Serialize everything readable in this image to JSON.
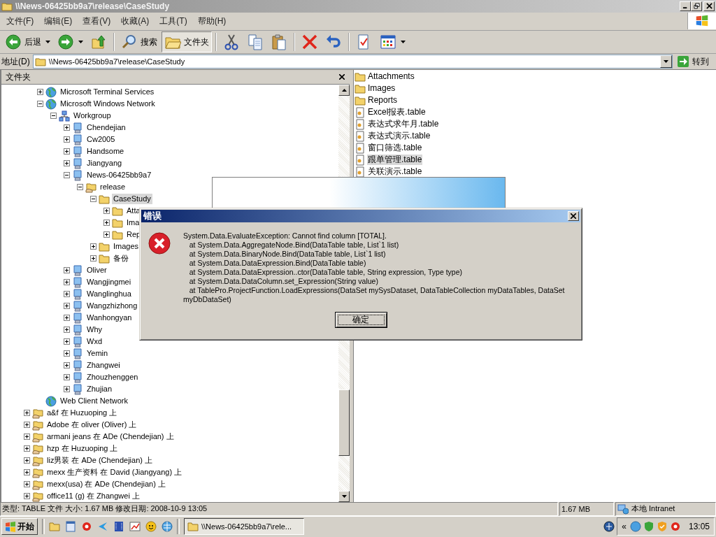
{
  "window": {
    "title": "\\\\News-06425bb9a7\\release\\CaseStudy"
  },
  "menu": [
    "文件(F)",
    "编辑(E)",
    "查看(V)",
    "收藏(A)",
    "工具(T)",
    "帮助(H)"
  ],
  "toolbar": [
    {
      "kind": "back",
      "label": "后退",
      "dropdown": true
    },
    {
      "kind": "forward",
      "dropdown": true
    },
    {
      "kind": "up",
      "dropdown": false
    },
    {
      "kind": "search",
      "label": "搜索",
      "dropdown": false,
      "selected": false
    },
    {
      "kind": "folders",
      "label": "文件夹",
      "dropdown": false,
      "selected": true
    },
    {
      "kind": "cut",
      "dropdown": false
    },
    {
      "kind": "copy",
      "dropdown": false
    },
    {
      "kind": "paste",
      "dropdown": false
    },
    {
      "kind": "delete",
      "dropdown": false
    },
    {
      "kind": "undo",
      "dropdown": false
    },
    {
      "kind": "properties",
      "dropdown": false
    },
    {
      "kind": "views",
      "dropdown": true
    }
  ],
  "address": {
    "label": "地址(D)",
    "value": "\\\\News-06425bb9a7\\release\\CaseStudy",
    "go": "转到"
  },
  "folders_pane": {
    "title": "文件夹",
    "tree": [
      {
        "kind": "network",
        "label": "Microsoft Terminal Services",
        "expanded": false,
        "selected": false
      },
      {
        "kind": "network",
        "label": "Microsoft Windows Network",
        "expanded": true,
        "selected": false,
        "children": [
          {
            "kind": "workgroup",
            "label": "Workgroup",
            "expanded": true,
            "selected": false,
            "children": [
              {
                "kind": "computer",
                "label": "Chendejian",
                "expanded": false,
                "selected": false
              },
              {
                "kind": "computer",
                "label": "Cw2005",
                "expanded": false,
                "selected": false
              },
              {
                "kind": "computer",
                "label": "Handsome",
                "expanded": false,
                "selected": false
              },
              {
                "kind": "computer",
                "label": "Jiangyang",
                "expanded": false,
                "selected": false
              },
              {
                "kind": "computer",
                "label": "News-06425bb9a7",
                "expanded": true,
                "selected": false,
                "children": [
                  {
                    "kind": "share",
                    "label": "release",
                    "expanded": true,
                    "selected": false,
                    "children": [
                      {
                        "kind": "folder",
                        "label": "CaseStudy",
                        "expanded": true,
                        "selected": true,
                        "children": [
                          {
                            "kind": "folder",
                            "label": "Atta",
                            "expanded": false,
                            "selected": false
                          },
                          {
                            "kind": "folder",
                            "label": "Ima",
                            "expanded": false,
                            "selected": false
                          },
                          {
                            "kind": "folder",
                            "label": "Rep",
                            "expanded": false,
                            "selected": false
                          }
                        ]
                      },
                      {
                        "kind": "folder",
                        "label": "Images",
                        "expanded": false,
                        "selected": false
                      },
                      {
                        "kind": "folder",
                        "label": "备份",
                        "expanded": false,
                        "selected": false
                      }
                    ]
                  }
                ]
              },
              {
                "kind": "computer",
                "label": "Oliver",
                "expanded": false,
                "selected": false
              },
              {
                "kind": "computer",
                "label": "Wangjingmei",
                "expanded": false,
                "selected": false
              },
              {
                "kind": "computer",
                "label": "Wanglinghua",
                "expanded": false,
                "selected": false
              },
              {
                "kind": "computer",
                "label": "Wangzhizhong",
                "expanded": false,
                "selected": false
              },
              {
                "kind": "computer",
                "label": "Wanhongyan",
                "expanded": false,
                "selected": false
              },
              {
                "kind": "computer",
                "label": "Why",
                "expanded": false,
                "selected": false
              },
              {
                "kind": "computer",
                "label": "Wxd",
                "expanded": false,
                "selected": false
              },
              {
                "kind": "computer",
                "label": "Yemin",
                "expanded": false,
                "selected": false
              },
              {
                "kind": "computer",
                "label": "Zhangwei",
                "expanded": false,
                "selected": false
              },
              {
                "kind": "computer",
                "label": "Zhouzhenggen",
                "expanded": false,
                "selected": false
              },
              {
                "kind": "computer",
                "label": "Zhujian",
                "expanded": false,
                "selected": false
              }
            ]
          }
        ]
      },
      {
        "kind": "network",
        "label": "Web Client Network",
        "selected": false
      },
      {
        "kind": "share",
        "label": "a&f 在 Huzuoping 上",
        "expanded": false,
        "selected": false
      },
      {
        "kind": "share",
        "label": "Adobe 在 oliver (Oliver) 上",
        "expanded": false,
        "selected": false
      },
      {
        "kind": "share",
        "label": "armani jeans 在 ADe (Chendejian) 上",
        "expanded": false,
        "selected": false
      },
      {
        "kind": "share",
        "label": "hzp 在 Huzuoping 上",
        "expanded": false,
        "selected": false
      },
      {
        "kind": "share",
        "label": "liz男装 在 ADe (Chendejian) 上",
        "expanded": false,
        "selected": false
      },
      {
        "kind": "share",
        "label": "mexx 生产资料 在 David (Jiangyang) 上",
        "expanded": false,
        "selected": false
      },
      {
        "kind": "share",
        "label": "mexx(usa) 在 ADe (Chendejian) 上",
        "expanded": false,
        "selected": false
      },
      {
        "kind": "share",
        "label": "office11 (g) 在 Zhangwei 上",
        "expanded": false,
        "selected": false
      }
    ]
  },
  "files": [
    {
      "kind": "folder",
      "name": "Attachments",
      "selected": false
    },
    {
      "kind": "folder",
      "name": "Images",
      "selected": false
    },
    {
      "kind": "folder",
      "name": "Reports",
      "selected": false
    },
    {
      "kind": "file",
      "name": "Excel报表.table",
      "selected": false
    },
    {
      "kind": "file",
      "name": "表达式求年月.table",
      "selected": false
    },
    {
      "kind": "file",
      "name": "表达式演示.table",
      "selected": false
    },
    {
      "kind": "file",
      "name": "窗口筛选.table",
      "selected": false
    },
    {
      "kind": "file",
      "name": "跟单管理.table",
      "selected": true
    },
    {
      "kind": "file",
      "name": "关联演示.table",
      "selected": false
    }
  ],
  "status_bar": {
    "info": "类型: TABLE 文件 大小: 1.67 MB 修改日期: 2008-10-9 13:05",
    "size": "1.67 MB",
    "zone": "本地 Intranet"
  },
  "taskbar": {
    "start": "开始",
    "task": "\\\\News-06425bb9a7\\rele...",
    "tray_toggle": "«",
    "clock": "13:05"
  },
  "dialog": {
    "title": "错误",
    "message": "System.Data.EvaluateException: Cannot find column [TOTAL].\n   at System.Data.AggregateNode.Bind(DataTable table, List`1 list)\n   at System.Data.BinaryNode.Bind(DataTable table, List`1 list)\n   at System.Data.DataExpression.Bind(DataTable table)\n   at System.Data.DataExpression..ctor(DataTable table, String expression, Type type)\n   at System.Data.DataColumn.set_Expression(String value)\n   at TablePro.ProjectFunction.LoadExpressions(DataSet mySysDataset, DataTableCollection myDataTables, DataSet\nmyDbDataSet)",
    "button": "确定"
  }
}
